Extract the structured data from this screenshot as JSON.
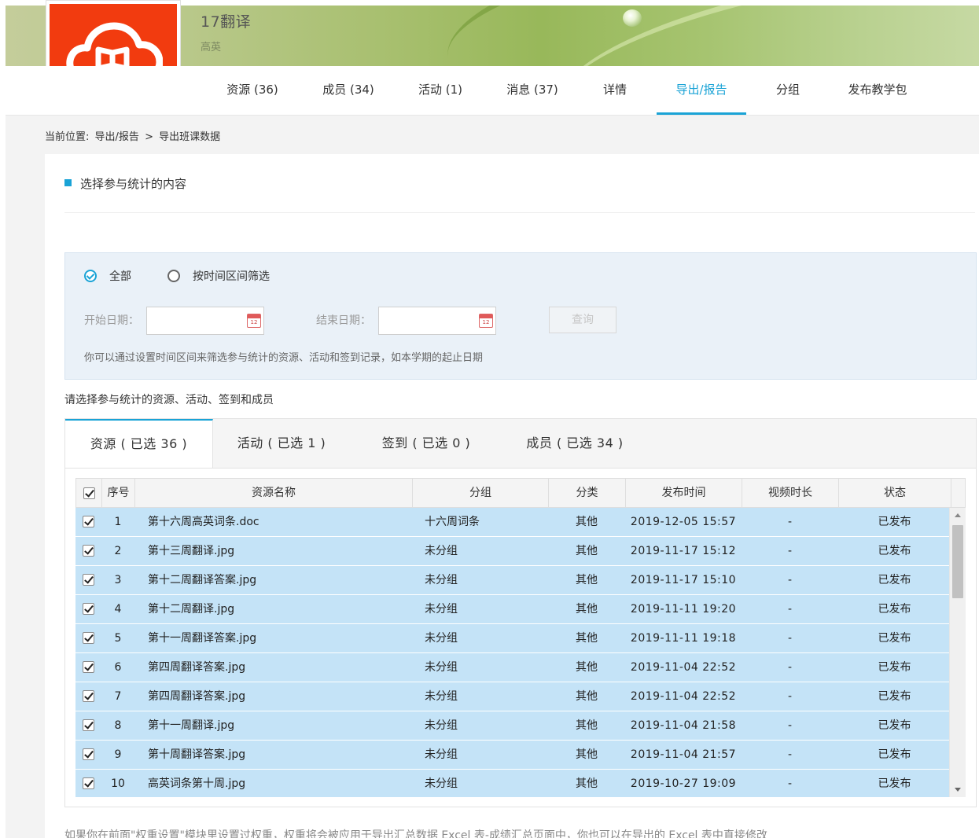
{
  "header": {
    "group_title": "17翻译",
    "group_subtitle": "高英"
  },
  "nav": {
    "items": [
      {
        "label": "资源 (36)"
      },
      {
        "label": "成员 (34)"
      },
      {
        "label": "活动 (1)"
      },
      {
        "label": "消息 (37)"
      },
      {
        "label": "详情"
      },
      {
        "label": "导出/报告",
        "active": true
      },
      {
        "label": "分组"
      },
      {
        "label": "发布教学包"
      }
    ]
  },
  "breadcrumb": {
    "prefix": "当前位置:",
    "parent": "导出/报告",
    "separator": ">",
    "current": "导出班课数据"
  },
  "section": {
    "title": "选择参与统计的内容"
  },
  "filter": {
    "option_all": "全部",
    "option_range": "按时间区间筛选",
    "selected": "全部",
    "start_label": "开始日期：",
    "start_value": "",
    "end_label": "结束日期：",
    "end_value": "",
    "calendar_day": "12",
    "query_button": "查询",
    "hint": "你可以通过设置时间区间来筛选参与统计的资源、活动和签到记录，如本学期的起止日期"
  },
  "select_title": "请选择参与统计的资源、活动、签到和成员",
  "tabs": [
    {
      "label": "资源 ( 已选 36 )",
      "active": true
    },
    {
      "label": "活动 ( 已选 1 )"
    },
    {
      "label": "签到 ( 已选 0 )"
    },
    {
      "label": "成员 ( 已选 34 )"
    }
  ],
  "table": {
    "columns": [
      "序号",
      "资源名称",
      "分组",
      "分类",
      "发布时间",
      "视频时长",
      "状态"
    ],
    "select_all_checked": true,
    "rows": [
      {
        "no": "1",
        "name": "第十六周高英词条.doc",
        "group": "十六周词条",
        "category": "其他",
        "time": "2019-12-05 15:57",
        "duration": "-",
        "status": "已发布",
        "checked": true
      },
      {
        "no": "2",
        "name": "第十三周翻译.jpg",
        "group": "未分组",
        "category": "其他",
        "time": "2019-11-17 15:12",
        "duration": "-",
        "status": "已发布",
        "checked": true
      },
      {
        "no": "3",
        "name": "第十二周翻译答案.jpg",
        "group": "未分组",
        "category": "其他",
        "time": "2019-11-17 15:10",
        "duration": "-",
        "status": "已发布",
        "checked": true
      },
      {
        "no": "4",
        "name": "第十二周翻译.jpg",
        "group": "未分组",
        "category": "其他",
        "time": "2019-11-11 19:20",
        "duration": "-",
        "status": "已发布",
        "checked": true
      },
      {
        "no": "5",
        "name": "第十一周翻译答案.jpg",
        "group": "未分组",
        "category": "其他",
        "time": "2019-11-11 19:18",
        "duration": "-",
        "status": "已发布",
        "checked": true
      },
      {
        "no": "6",
        "name": "第四周翻译答案.jpg",
        "group": "未分组",
        "category": "其他",
        "time": "2019-11-04 22:52",
        "duration": "-",
        "status": "已发布",
        "checked": true
      },
      {
        "no": "7",
        "name": "第四周翻译答案.jpg",
        "group": "未分组",
        "category": "其他",
        "time": "2019-11-04 22:52",
        "duration": "-",
        "status": "已发布",
        "checked": true
      },
      {
        "no": "8",
        "name": "第十一周翻译.jpg",
        "group": "未分组",
        "category": "其他",
        "time": "2019-11-04 21:58",
        "duration": "-",
        "status": "已发布",
        "checked": true
      },
      {
        "no": "9",
        "name": "第十周翻译答案.jpg",
        "group": "未分组",
        "category": "其他",
        "time": "2019-11-04 21:57",
        "duration": "-",
        "status": "已发布",
        "checked": true
      },
      {
        "no": "10",
        "name": "高英词条第十周.jpg",
        "group": "未分组",
        "category": "其他",
        "time": "2019-10-27 19:09",
        "duration": "-",
        "status": "已发布",
        "checked": true
      }
    ]
  },
  "bottom_note": "如果你在前面\"权重设置\"模块里设置过权重，权重将会被应用于导出汇总数据 Excel 表-成绩汇总页面中，你也可以在导出的 Excel 表中直接修改",
  "colors": {
    "accent": "#1aa3d6",
    "logo_red": "#f23b0f",
    "row_selected": "#c4e3f7",
    "filter_bg": "#eaf1f8"
  }
}
